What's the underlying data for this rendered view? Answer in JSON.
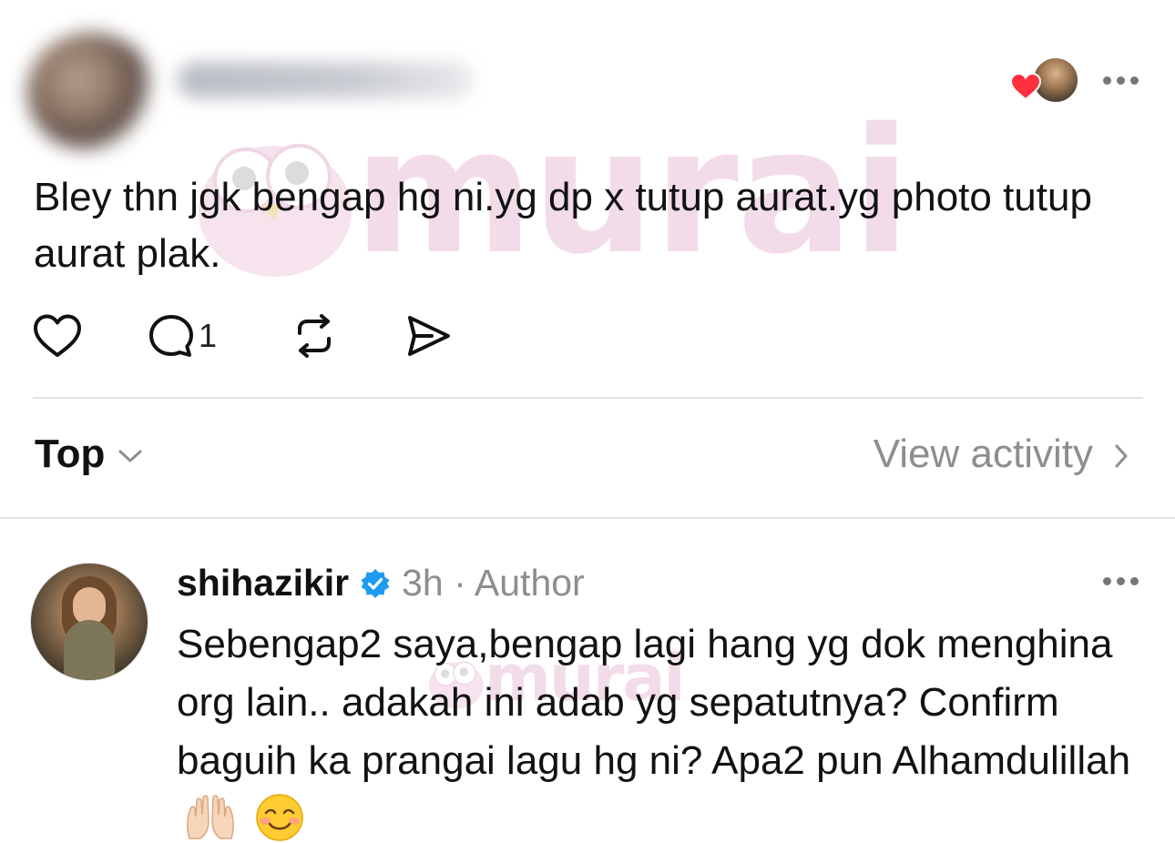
{
  "post": {
    "text": "Bley thn jgk bengap hg ni.yg dp x tutup aurat.yg photo tutup aurat plak.",
    "comment_count": "1"
  },
  "sort": {
    "label": "Top",
    "view_activity": "View activity"
  },
  "reply": {
    "username": "shihazikir",
    "meta": "3h · Author",
    "text": "Sebengap2 saya,bengap lagi hang yg dok menghina org lain.. adakah ini adab yg sepatutnya? Confirm baguih ka prangai lagu hg ni? Apa2 pun Alhamdulillah"
  },
  "watermark": {
    "text": "murai"
  },
  "colors": {
    "verified": "#1d9bf0",
    "like_heart": "#ff3040",
    "muted_text": "#8e8e8e"
  },
  "icons": [
    "heart-icon",
    "comment-icon",
    "repost-icon",
    "share-icon",
    "chevron-down-icon",
    "chevron-right-icon",
    "verified-badge-icon",
    "more-icon"
  ]
}
